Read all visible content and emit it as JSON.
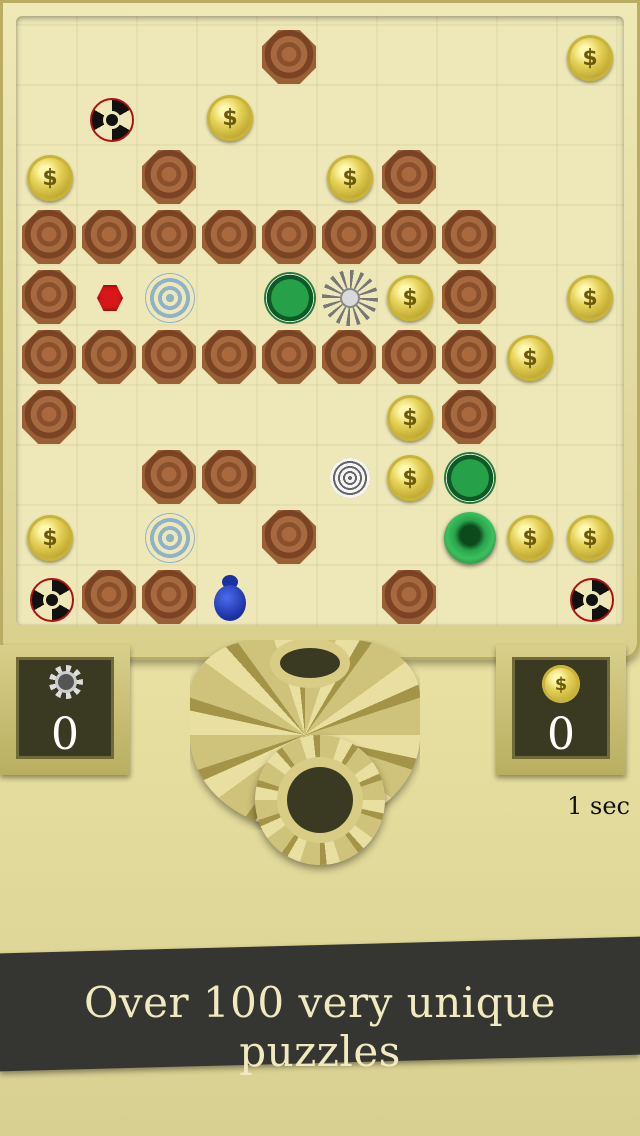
{
  "counters": {
    "gears_count": "0",
    "coins_count": "0"
  },
  "timer": "1 sec",
  "banner": "Over 100 very unique puzzles",
  "coin_symbol": "$",
  "colors": {
    "background": "#e9e2a6",
    "banner": "#353531",
    "banner_text": "#f1eac0",
    "rock": "#8a4f2b",
    "coin": "#e6d35a",
    "gem": "#d81818",
    "beetle": "#1a2fa0"
  }
}
